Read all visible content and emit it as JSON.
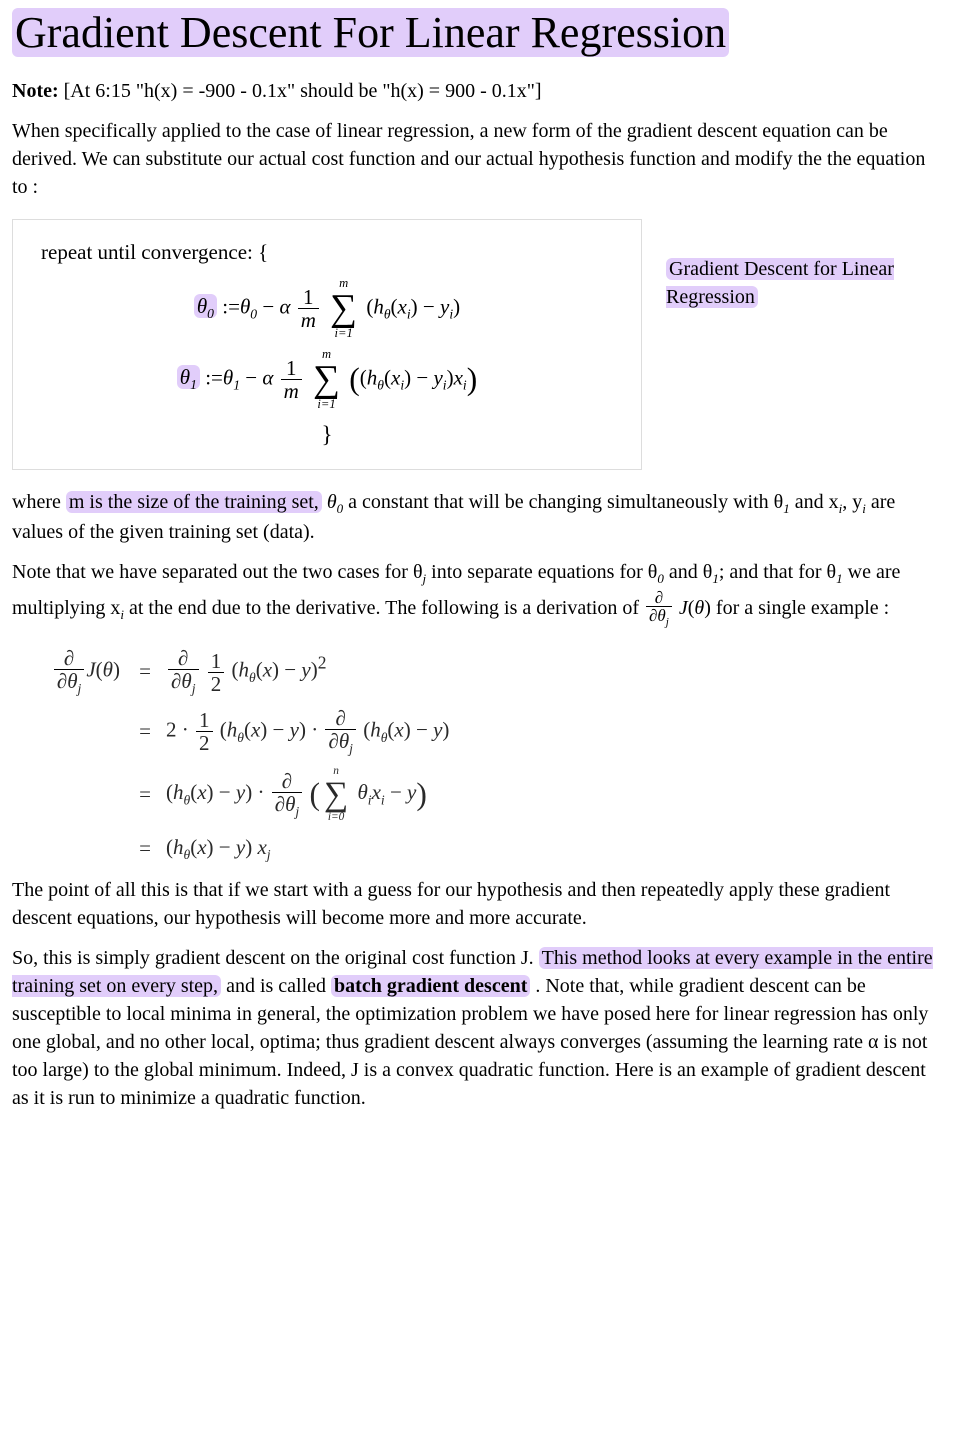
{
  "title": "Gradient Descent For Linear Regression",
  "note": {
    "label": "Note:",
    "text": "[At 6:15 \"h(x) = -900 - 0.1x\" should be \"h(x) = 900 - 0.1x\"]"
  },
  "p1": "When specifically applied to the case of linear regression, a new form of the gradient descent equation can be derived. We can substitute our actual cost function and our actual hypothesis function and modify the the equation to :",
  "mathblock": {
    "header": "repeat until convergence: {",
    "line1_plain": "θ0 := θ0 − α (1/m) Σ_{i=1}^{m} (h_θ(x_i) − y_i)",
    "line2_plain": "θ1 := θ1 − α (1/m) Σ_{i=1}^{m} ((h_θ(x_i) − y_i) x_i)",
    "close": "}"
  },
  "side_caption": "Gradient Descent for Linear Regression",
  "p2": {
    "prefix": "where ",
    "hl": "m is the size of the training set,",
    "rest1": " θ",
    "rest1_sub": "0",
    "rest2": " a constant that will be changing simultaneously with θ",
    "rest2_sub": "1",
    "rest3": " and x",
    "rest3_sub": "i",
    "rest4": ", y",
    "rest4_sub": "i",
    "rest5": " are values of the given training set (data)."
  },
  "p3": {
    "seg1": "Note that we have separated out the two cases for θ",
    "sub_j": "j",
    "seg2": " into separate equations for θ",
    "sub_0": "0",
    "seg3": " and θ",
    "sub_1": "1",
    "seg4": "; and that for θ",
    "seg5": " we are multiplying x",
    "sub_i": "i",
    "seg6": " at the end due to the derivative. The following is a derivation of ",
    "partial": "∂/∂θ_j J(θ)",
    "seg7": " for a single example :"
  },
  "derivation": {
    "line1_lhs": "∂/∂θ_j J(θ)",
    "line1_rhs": "∂/∂θ_j ½ (h_θ(x) − y)²",
    "line2_rhs": "2 · ½ (h_θ(x) − y) · ∂/∂θ_j (h_θ(x) − y)",
    "line3_rhs": "(h_θ(x) − y) · ∂/∂θ_j ( Σ_{i=0}^{n} θ_i x_i − y )",
    "line4_rhs": "(h_θ(x) − y) x_j"
  },
  "p4": "The point of all this is that if we start with a guess for our hypothesis and then repeatedly apply these gradient descent equations, our hypothesis will become more and more accurate.",
  "p5": {
    "pre": "So, this is simply gradient descent on the original cost function J. ",
    "hl1": "This method looks at every example in the entire training set on every step,",
    "mid": " and is called ",
    "hl2": "batch gradient descent",
    "post": " . Note that, while gradient descent can be susceptible to local minima in general, the optimization problem we have posed here for linear regression has only one global, and no other local, optima; thus gradient descent always converges (assuming the learning rate α is not too large) to the global minimum. Indeed, J is a convex quadratic function. Here is an example of gradient descent as it is run to minimize a quadratic function."
  }
}
